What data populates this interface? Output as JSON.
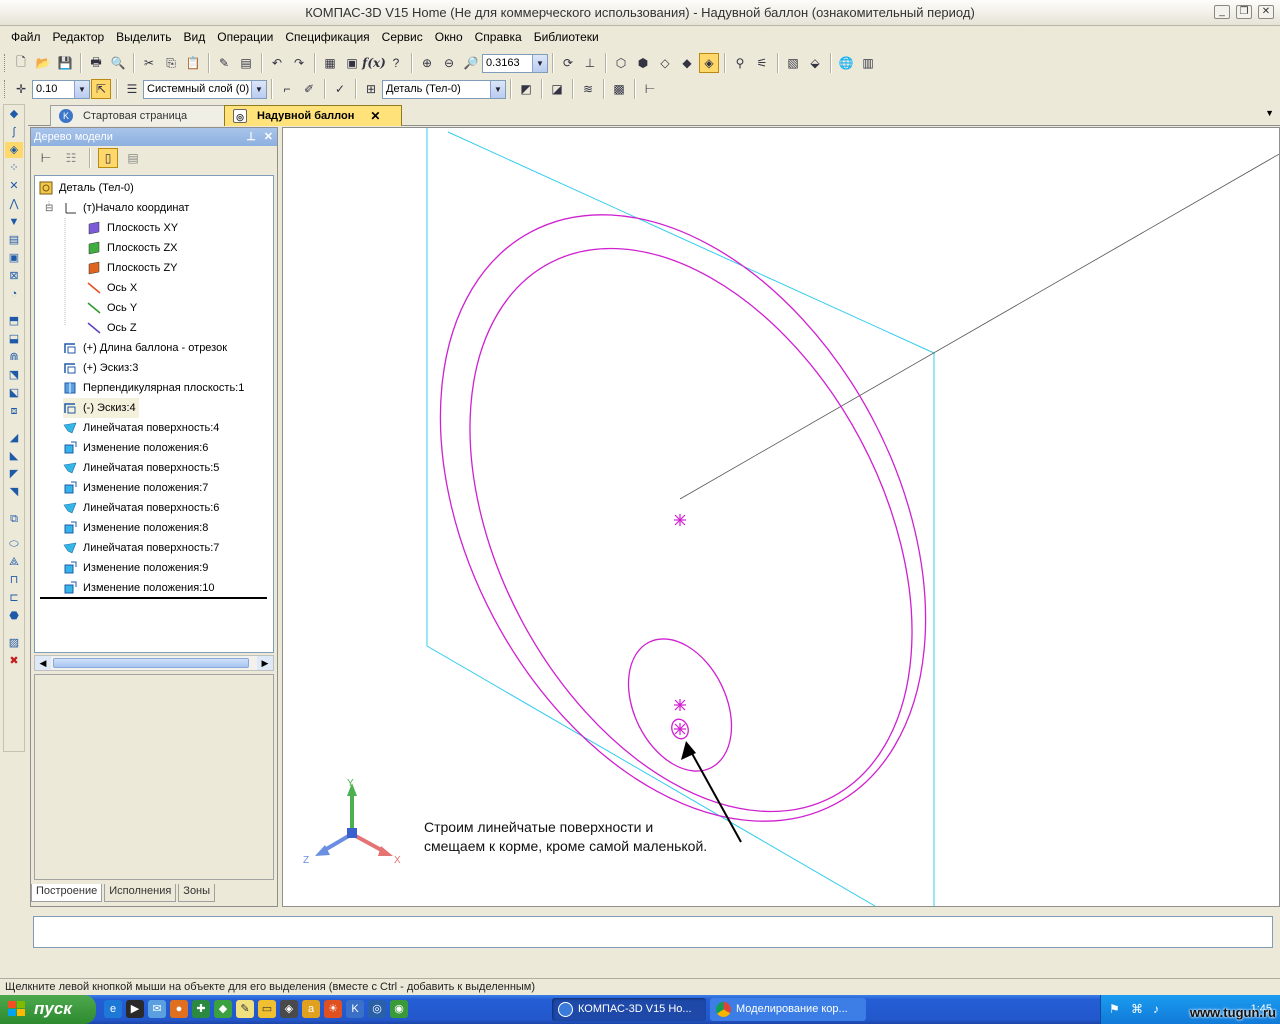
{
  "window": {
    "title": "КОМПАС-3D V15 Home (Не для коммерческого использования) - Надувной баллон (ознакомительный период)"
  },
  "menu": [
    "Файл",
    "Редактор",
    "Выделить",
    "Вид",
    "Операции",
    "Спецификация",
    "Сервис",
    "Окно",
    "Справка",
    "Библиотеки"
  ],
  "toolbar1": {
    "zoom_value": "0.3163"
  },
  "toolbar2": {
    "step_value": "0.10",
    "layer_value": "Системный слой (0)",
    "detail_value": "Деталь (Тел-0)"
  },
  "tabs": [
    {
      "label": "Стартовая страница"
    },
    {
      "label": "Надувной баллон"
    }
  ],
  "tree": {
    "title": "Дерево модели",
    "nodes": [
      {
        "label": "Деталь (Тел-0)",
        "icon": "part-icon"
      },
      {
        "label": "(т)Начало координат",
        "icon": "origin-icon"
      },
      {
        "label": "Плоскость XY",
        "icon": "plane-xy-icon",
        "color": "#7d5ad8"
      },
      {
        "label": "Плоскость ZX",
        "icon": "plane-zx-icon",
        "color": "#3fae3f"
      },
      {
        "label": "Плоскость ZY",
        "icon": "plane-zy-icon",
        "color": "#e06420"
      },
      {
        "label": "Ось X",
        "icon": "axis-x-icon",
        "color": "#e05020"
      },
      {
        "label": "Ось Y",
        "icon": "axis-y-icon",
        "color": "#2a9a2a"
      },
      {
        "label": "Ось Z",
        "icon": "axis-z-icon",
        "color": "#6040c0"
      },
      {
        "label": "(+) Длина баллона - отрезок",
        "icon": "sketch-icon"
      },
      {
        "label": "(+) Эскиз:3",
        "icon": "sketch-icon"
      },
      {
        "label": "Перпендикулярная плоскость:1",
        "icon": "plane-icon"
      },
      {
        "label": "(-) Эскиз:4",
        "icon": "sketch-icon"
      },
      {
        "label": "Линейчатая поверхность:4",
        "icon": "ruled-surface-icon"
      },
      {
        "label": "Изменение положения:6",
        "icon": "move-icon"
      },
      {
        "label": "Линейчатая поверхность:5",
        "icon": "ruled-surface-icon"
      },
      {
        "label": "Изменение положения:7",
        "icon": "move-icon"
      },
      {
        "label": "Линейчатая поверхность:6",
        "icon": "ruled-surface-icon"
      },
      {
        "label": "Изменение положения:8",
        "icon": "move-icon"
      },
      {
        "label": "Линейчатая поверхность:7",
        "icon": "ruled-surface-icon"
      },
      {
        "label": "Изменение положения:9",
        "icon": "move-icon"
      },
      {
        "label": "Изменение положения:10",
        "icon": "move-icon"
      }
    ],
    "bottom_tabs": [
      "Построение",
      "Исполнения",
      "Зоны"
    ]
  },
  "viewport": {
    "annotation_line1": "Строим линейчатые поверхности и",
    "annotation_line2": "смещаем к корме, кроме самой маленькой.",
    "axis_labels": {
      "x": "X",
      "y": "Y",
      "z": "Z"
    },
    "colors": {
      "plane": "#33ccee",
      "curves": "#d020d0",
      "axis_line": "#555555"
    }
  },
  "status": {
    "text": "Щелкните левой кнопкой мыши на объекте для его выделения (вместе с Ctrl - добавить к выделенным)"
  },
  "taskbar": {
    "start_label": "пуск",
    "tasks": [
      "КОМПАС-3D V15 Ho...",
      "Моделирование кор..."
    ],
    "lang": "RL",
    "clock": "1:45",
    "watermark": "www.tugun.ru"
  }
}
